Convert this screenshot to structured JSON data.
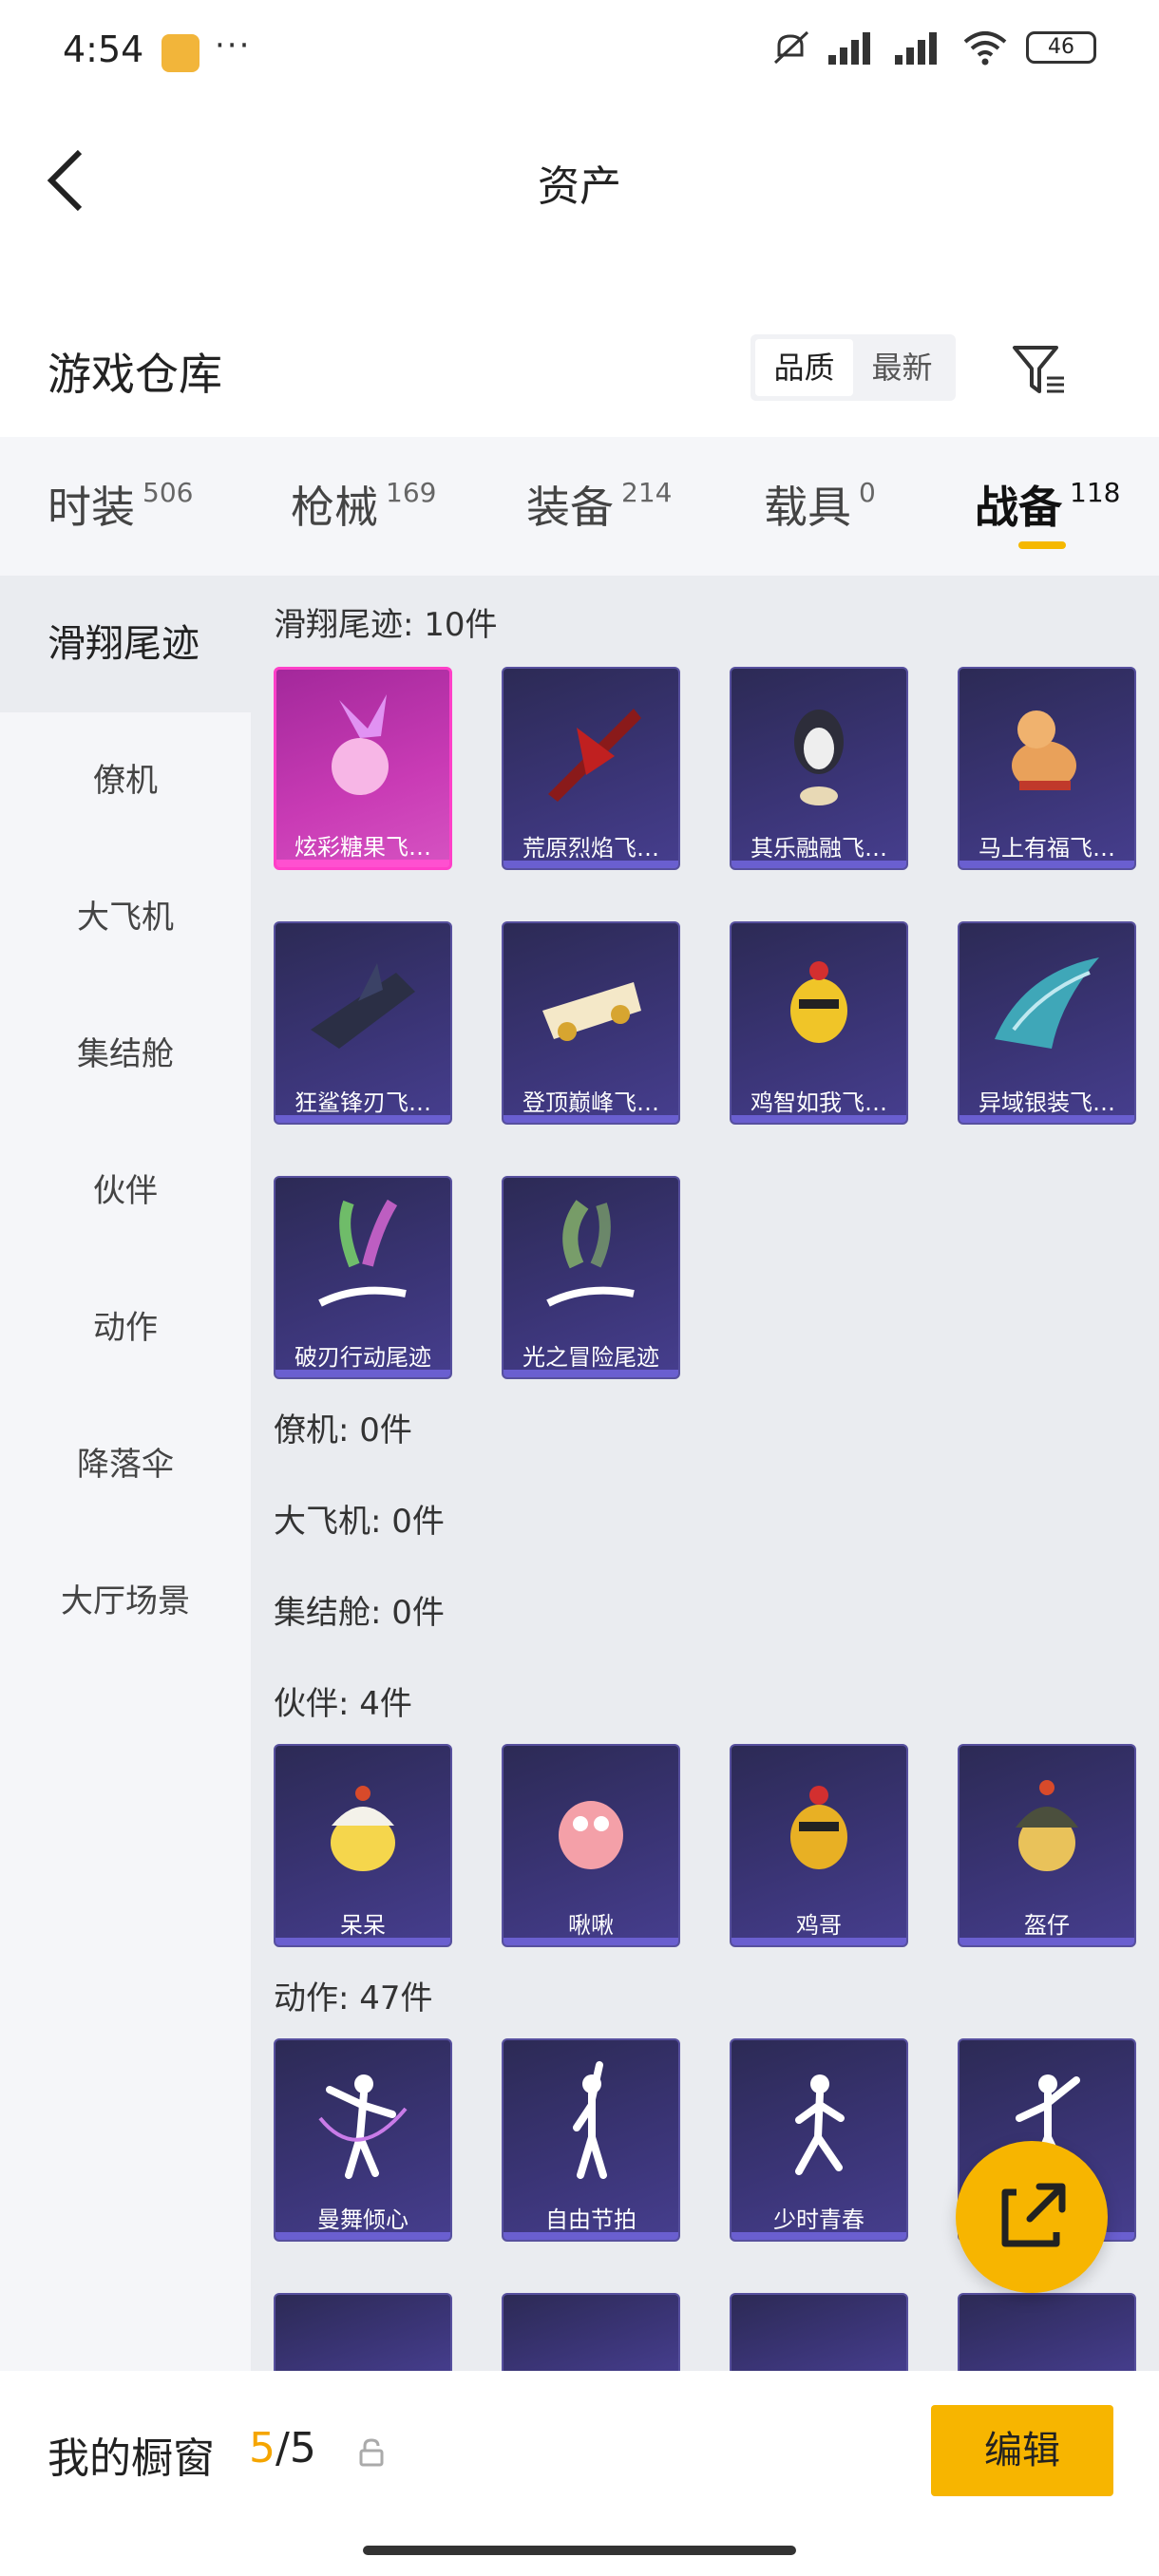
{
  "status_bar": {
    "time": "4:54",
    "dots": "···",
    "battery": "46"
  },
  "nav": {
    "title": "资产"
  },
  "warehouse": {
    "title": "游戏仓库",
    "sort_options": [
      "品质",
      "最新"
    ],
    "active_sort": "品质"
  },
  "categories": [
    {
      "label": "时装",
      "count": "506"
    },
    {
      "label": "枪械",
      "count": "169"
    },
    {
      "label": "装备",
      "count": "214"
    },
    {
      "label": "载具",
      "count": "0"
    },
    {
      "label": "战备",
      "count": "118"
    }
  ],
  "active_category": "战备",
  "sidebar": [
    "滑翔尾迹",
    "僚机",
    "大飞机",
    "集结舱",
    "伙伴",
    "动作",
    "降落伞",
    "大厅场景"
  ],
  "sections": {
    "glide_trail": {
      "title": "滑翔尾迹: 10件",
      "items": [
        "炫彩糖果飞…",
        "荒原烈焰飞…",
        "其乐融融飞…",
        "马上有福飞…",
        "狂鲨锋刃飞…",
        "登顶巅峰飞…",
        "鸡智如我飞…",
        "异域银装飞…",
        "破刃行动尾迹",
        "光之冒险尾迹"
      ]
    },
    "wingman": {
      "title": "僚机: 0件"
    },
    "big_plane": {
      "title": "大飞机: 0件"
    },
    "assembly_pod": {
      "title": "集结舱: 0件"
    },
    "partner": {
      "title": "伙伴: 4件",
      "items": [
        "呆呆",
        "啾啾",
        "鸡哥",
        "盔仔"
      ]
    },
    "emote": {
      "title": "动作: 47件",
      "items": [
        "曼舞倾心",
        "自由节拍",
        "少时青春",
        ""
      ]
    }
  },
  "bottom": {
    "showcase_label": "我的橱窗",
    "showcase_current": "5",
    "showcase_total": "/5",
    "edit_label": "编辑"
  },
  "colors": {
    "accent": "#f7b500",
    "card_bg": "#3a3475",
    "selected_card": "#c93bb5"
  }
}
